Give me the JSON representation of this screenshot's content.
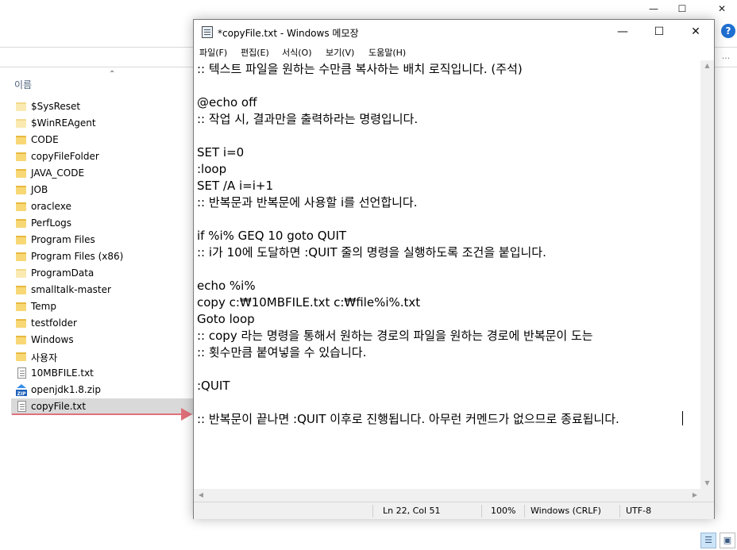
{
  "explorer": {
    "address_text": "",
    "search_glyph": "...",
    "column_header": "이름",
    "help_label": "?",
    "files": [
      {
        "name": "$SysReset",
        "type": "folder-light"
      },
      {
        "name": "$WinREAgent",
        "type": "folder-light"
      },
      {
        "name": "CODE",
        "type": "folder"
      },
      {
        "name": "copyFileFolder",
        "type": "folder"
      },
      {
        "name": "JAVA_CODE",
        "type": "folder"
      },
      {
        "name": "JOB",
        "type": "folder"
      },
      {
        "name": "oraclexe",
        "type": "folder"
      },
      {
        "name": "PerfLogs",
        "type": "folder"
      },
      {
        "name": "Program Files",
        "type": "folder"
      },
      {
        "name": "Program Files (x86)",
        "type": "folder"
      },
      {
        "name": "ProgramData",
        "type": "folder-light"
      },
      {
        "name": "smalltalk-master",
        "type": "folder"
      },
      {
        "name": "Temp",
        "type": "folder"
      },
      {
        "name": "testfolder",
        "type": "folder"
      },
      {
        "name": "Windows",
        "type": "folder"
      },
      {
        "name": "사용자",
        "type": "folder"
      },
      {
        "name": "10MBFILE.txt",
        "type": "txt"
      },
      {
        "name": "openjdk1.8.zip",
        "type": "zip"
      },
      {
        "name": "copyFile.txt",
        "type": "txt",
        "selected": true
      }
    ]
  },
  "notepad": {
    "title": "*copyFile.txt - Windows 메모장",
    "menu": [
      "파일(F)",
      "편집(E)",
      "서식(O)",
      "보기(V)",
      "도움말(H)"
    ],
    "lines": [
      ":: 텍스트 파일을 원하는 수만큼 복사하는 배치 로직입니다. (주석)",
      "",
      "@echo off",
      ":: 작업 시, 결과만을 출력하라는 명령입니다.",
      "",
      "SET i=0",
      ":loop",
      "SET /A i=i+1",
      ":: 반복문과 반복문에 사용할 i를 선언합니다.",
      "",
      "if %i% GEQ 10 goto QUIT",
      ":: i가 10에 도달하면 :QUIT 줄의 명령을 실행하도록 조건을 붙입니다.",
      "",
      "echo %i%",
      "copy c:₩10MBFILE.txt c:₩file%i%.txt",
      "Goto loop",
      ":: copy 라는 명령을 통해서 원하는 경로의 파일을 원하는 경로에 반복문이 도는",
      ":: 횟수만큼 붙여넣을 수 있습니다.",
      "",
      ":QUIT",
      "",
      ":: 반복문이 끝나면 :QUIT 이후로 진행됩니다. 아무런 커멘드가 없으므로 종료됩니다."
    ],
    "status": {
      "position": "Ln 22, Col 51",
      "zoom": "100%",
      "line_ending": "Windows (CRLF)",
      "encoding": "UTF-8"
    }
  },
  "colors": {
    "selection": "#d9d9d9",
    "arrow": "#e0707a",
    "folder": "#f8d775",
    "help": "#1e6fd0"
  }
}
